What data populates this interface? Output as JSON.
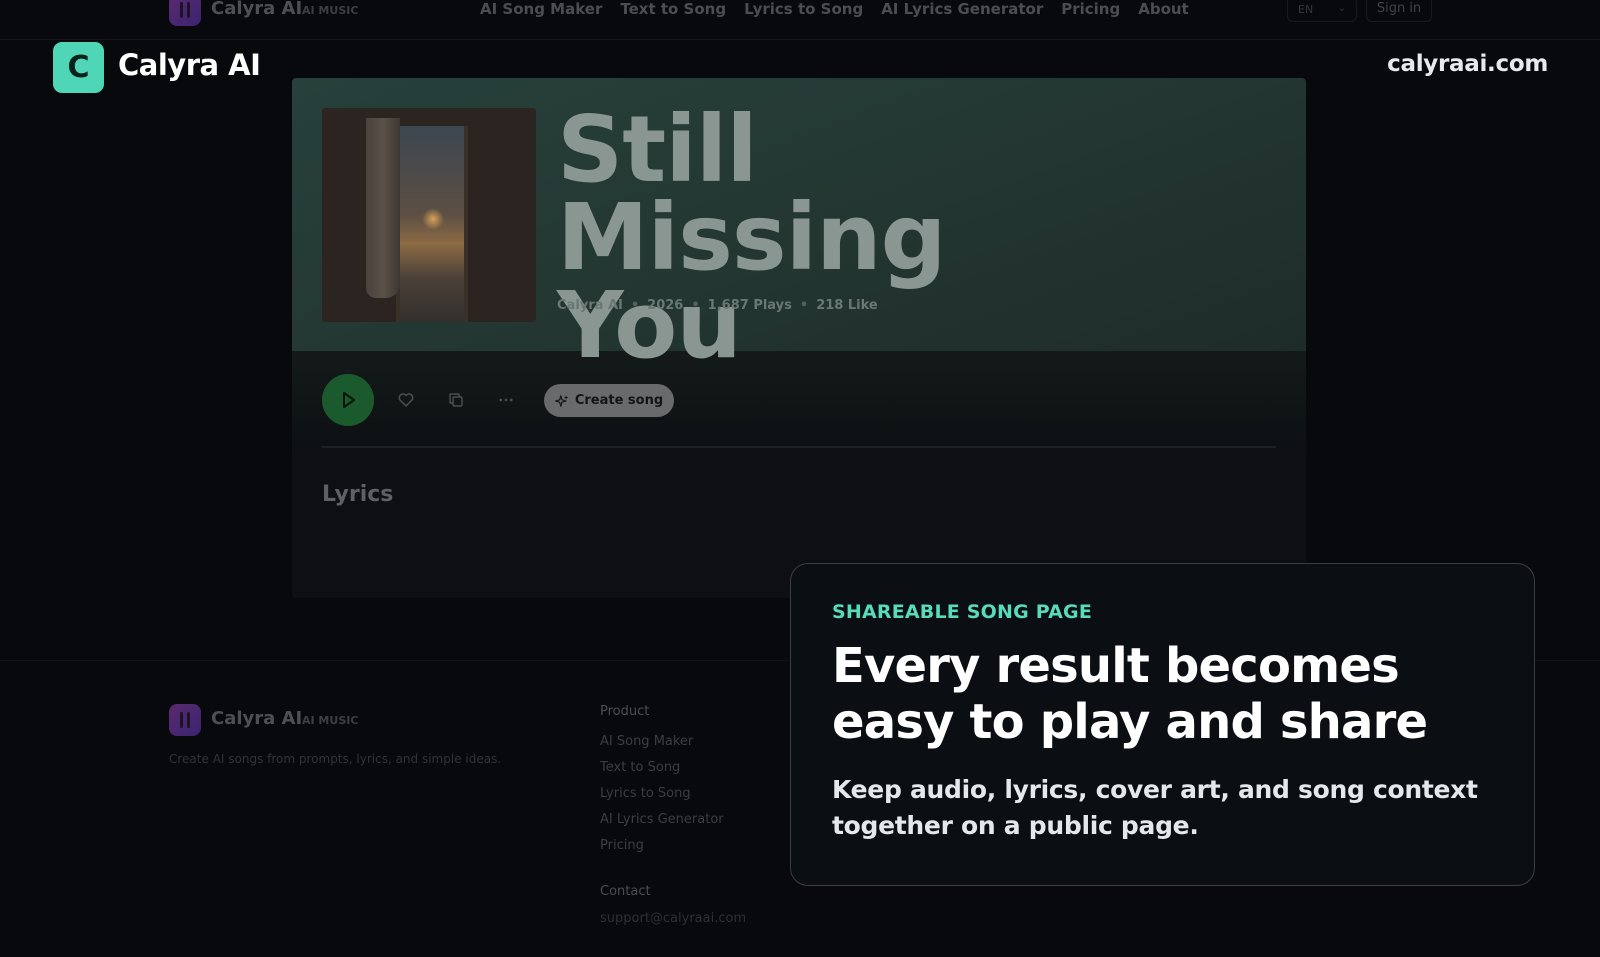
{
  "site": {
    "nav": {
      "logo_name": "Calyra AI",
      "logo_sub": "AI MUSIC",
      "links": [
        "AI Song Maker",
        "Text to Song",
        "Lyrics to Song",
        "AI Lyrics Generator",
        "Pricing",
        "About"
      ],
      "language": "EN",
      "sign_in": "Sign in"
    },
    "song": {
      "title": "Still Missing You",
      "artist": "Calyra AI",
      "year": "2026",
      "plays": "1,687 Plays",
      "likes": "218 Like",
      "create_button": "Create song",
      "lyrics_heading": "Lyrics"
    },
    "footer": {
      "logo_name": "Calyra AI",
      "logo_sub": "AI MUSIC",
      "tagline": "Create AI songs from prompts, lyrics, and simple ideas.",
      "product_heading": "Product",
      "product_links": [
        "AI Song Maker",
        "Text to Song",
        "Lyrics to Song",
        "AI Lyrics Generator",
        "Pricing"
      ],
      "contact_heading": "Contact",
      "contact_email": "support@calyraai.com"
    }
  },
  "overlay": {
    "brand_letter": "C",
    "brand_name": "Calyra AI",
    "domain": "calyraai.com",
    "card": {
      "eyebrow": "SHAREABLE SONG PAGE",
      "headline": "Every result becomes easy to play and share",
      "body": "Keep audio, lyrics, cover art, and song context together on a public page."
    }
  },
  "colors": {
    "accent": "#58dbbb",
    "brand_mark": "#4fd6b6",
    "background": "#07090c",
    "play_button": "#1a5a2c"
  },
  "icons": {
    "play": "play-icon",
    "like": "heart-icon",
    "copy": "copy-icon",
    "more": "more-horizontal-icon",
    "sparkle": "sparkle-icon",
    "chevron": "chevron-down-icon"
  }
}
